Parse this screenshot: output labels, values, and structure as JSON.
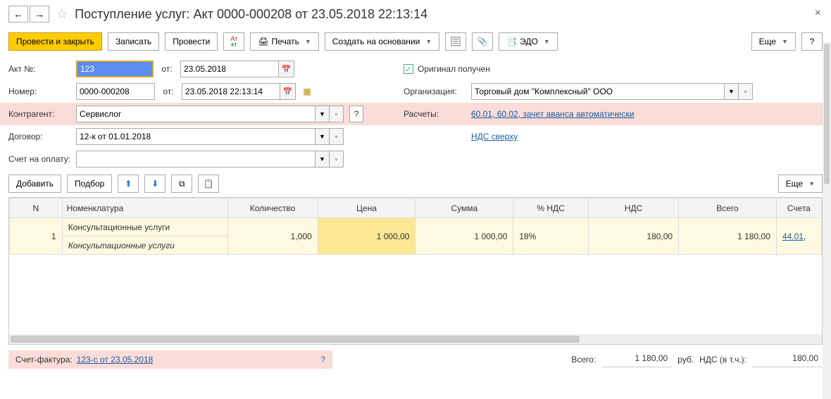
{
  "header": {
    "title": "Поступление услуг: Акт 0000-000208 от 23.05.2018 22:13:14"
  },
  "toolbar": {
    "post_close": "Провести и закрыть",
    "write": "Записать",
    "post": "Провести",
    "print": "Печать",
    "create_based": "Создать на основании",
    "edo": "ЭДО",
    "more": "Еще",
    "help": "?"
  },
  "form": {
    "act_no_label": "Акт №:",
    "act_no_value": "123",
    "from_label": "от:",
    "act_date": "23.05.2018",
    "original_received": "Оригинал получен",
    "number_label": "Номер:",
    "number_value": "0000-000208",
    "number_date": "23.05.2018 22:13:14",
    "organization_label": "Организация:",
    "organization_value": "Торговый дом \"Комплексный\" ООО",
    "counterparty_label": "Контрагент:",
    "counterparty_value": "Сервислог",
    "settlements_label": "Расчеты:",
    "settlements_link": "60.01, 60.02, зачет аванса автоматически",
    "contract_label": "Договор:",
    "contract_value": "12-к от 01.01.2018",
    "vat_link": "НДС сверху",
    "invoice_label": "Счет на оплату:"
  },
  "table_toolbar": {
    "add": "Добавить",
    "pick": "Подбор",
    "more": "Еще"
  },
  "table": {
    "headers": {
      "n": "N",
      "nomenclature": "Номенклатура",
      "qty": "Количество",
      "price": "Цена",
      "sum": "Сумма",
      "vat_rate": "% НДС",
      "vat": "НДС",
      "total": "Всего",
      "accounts": "Счета"
    },
    "rows": [
      {
        "n": "1",
        "nomenclature": "Консультационные услуги",
        "nomenclature2": "Консультационные услуги",
        "qty": "1,000",
        "price": "1 000,00",
        "sum": "1 000,00",
        "vat_rate": "18%",
        "vat": "180,00",
        "total": "1 180,00",
        "account": "44.01,"
      }
    ]
  },
  "footer": {
    "invoice_label": "Счет-фактура:",
    "invoice_link": "123-с от 23.05.2018",
    "total_label": "Всего:",
    "total_value": "1 180,00",
    "currency": "руб.",
    "vat_label": "НДС (в т.ч.):",
    "vat_value": "180,00"
  }
}
